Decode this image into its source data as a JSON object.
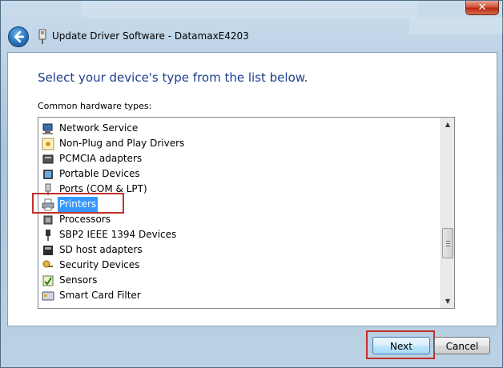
{
  "window": {
    "title": "Update Driver Software - DatamaxE4203",
    "close_glyph": "✕"
  },
  "page": {
    "heading": "Select your device's type from the list below.",
    "list_label": "Common hardware types:"
  },
  "hardware_list": {
    "items": [
      {
        "label": "Network Service",
        "icon": "network-service-icon"
      },
      {
        "label": "Non-Plug and Play Drivers",
        "icon": "non-pnp-driver-icon"
      },
      {
        "label": "PCMCIA adapters",
        "icon": "pcmcia-adapter-icon"
      },
      {
        "label": "Portable Devices",
        "icon": "portable-device-icon"
      },
      {
        "label": "Ports (COM & LPT)",
        "icon": "port-icon"
      },
      {
        "label": "Printers",
        "icon": "printer-icon",
        "selected": true
      },
      {
        "label": "Processors",
        "icon": "processor-icon"
      },
      {
        "label": "SBP2 IEEE 1394 Devices",
        "icon": "ieee1394-device-icon"
      },
      {
        "label": "SD host adapters",
        "icon": "sd-host-adapter-icon"
      },
      {
        "label": "Security Devices",
        "icon": "security-device-icon"
      },
      {
        "label": "Sensors",
        "icon": "sensor-icon"
      },
      {
        "label": "Smart Card Filter",
        "icon": "smart-card-filter-icon"
      }
    ],
    "scroll_up_glyph": "▲",
    "scroll_down_glyph": "▼"
  },
  "footer": {
    "next_label": "Next",
    "cancel_label": "Cancel"
  },
  "colors": {
    "selection": "#3399ff",
    "highlight_box": "#c0302a",
    "heading": "#1e3d8f"
  }
}
